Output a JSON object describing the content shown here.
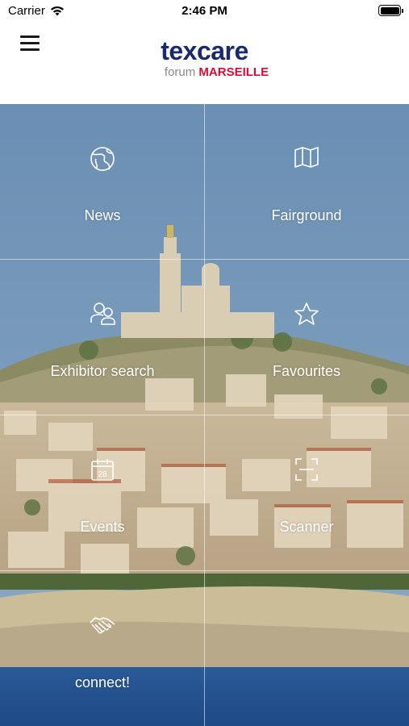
{
  "status_bar": {
    "carrier": "Carrier",
    "time": "2:46 PM"
  },
  "header": {
    "logo_main": "texcare",
    "logo_sub_a": "forum",
    "logo_sub_b": "MARSEILLE"
  },
  "tiles": [
    {
      "label": "News",
      "icon": "globe-icon"
    },
    {
      "label": "Fairground",
      "icon": "map-icon"
    },
    {
      "label": "Exhibitor search",
      "icon": "people-icon"
    },
    {
      "label": "Favourites",
      "icon": "star-icon"
    },
    {
      "label": "Events",
      "icon": "calendar-icon",
      "calendar_day": "28"
    },
    {
      "label": "Scanner",
      "icon": "scanner-icon"
    },
    {
      "label": "connect!",
      "icon": "handshake-icon"
    }
  ],
  "colors": {
    "brand_blue": "#1a2a6c",
    "brand_red": "#d40d3a"
  }
}
